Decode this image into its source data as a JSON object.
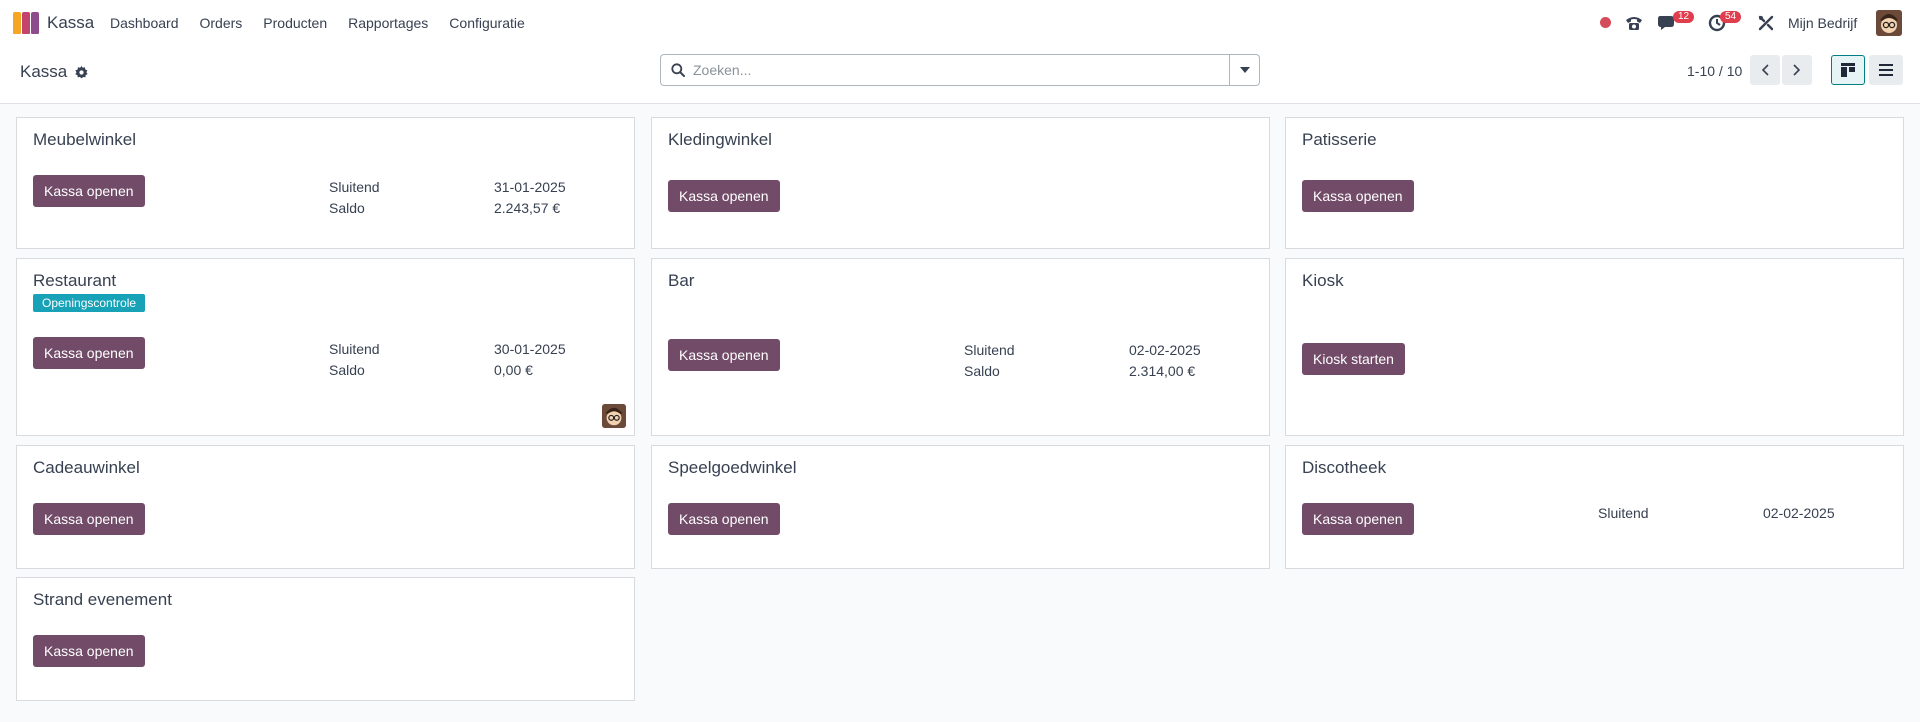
{
  "app": {
    "name": "Kassa"
  },
  "menu": [
    "Dashboard",
    "Orders",
    "Producten",
    "Rapportages",
    "Configuratie"
  ],
  "systray": {
    "chat_count": "12",
    "activity_count": "54",
    "company": "Mijn Bedrijf"
  },
  "control": {
    "breadcrumb": "Kassa",
    "search_placeholder": "Zoeken...",
    "pager": "1-10 / 10"
  },
  "colors": {
    "primary": "#714b67",
    "accent": "#017e84",
    "tag": "#17a2b8",
    "recording": "#d44c59",
    "badge": "#e03e4d"
  },
  "cards": [
    {
      "name": "Meubelwinkel",
      "button": "Kassa openen",
      "closing_label": "Sluitend",
      "closing_date": "31-01-2025",
      "balance_label": "Saldo",
      "balance": "2.243,57 €"
    },
    {
      "name": "Kledingwinkel",
      "button": "Kassa openen"
    },
    {
      "name": "Patisserie",
      "button": "Kassa openen"
    },
    {
      "name": "Restaurant",
      "tag": "Openingscontrole",
      "button": "Kassa openen",
      "closing_label": "Sluitend",
      "closing_date": "30-01-2025",
      "balance_label": "Saldo",
      "balance": "0,00 €"
    },
    {
      "name": "Bar",
      "button": "Kassa openen",
      "closing_label": "Sluitend",
      "closing_date": "02-02-2025",
      "balance_label": "Saldo",
      "balance": "2.314,00 €"
    },
    {
      "name": "Kiosk",
      "button": "Kiosk starten"
    },
    {
      "name": "Cadeauwinkel",
      "button": "Kassa openen"
    },
    {
      "name": "Speelgoedwinkel",
      "button": "Kassa openen"
    },
    {
      "name": "Discotheek",
      "button": "Kassa openen",
      "closing_label": "Sluitend",
      "closing_date": "02-02-2025"
    },
    {
      "name": "Strand evenement",
      "button": "Kassa openen"
    }
  ]
}
